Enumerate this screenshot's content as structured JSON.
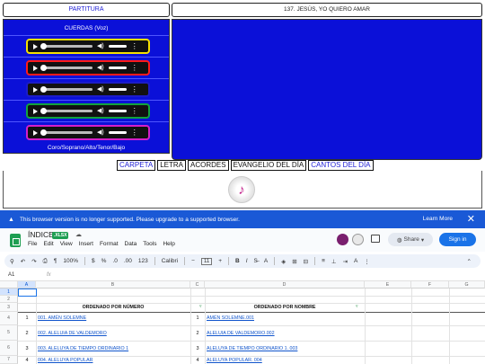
{
  "partitura": "PARTITURA",
  "song_title": "137. JESÚS, YO QUIERO AMAR",
  "cuerdas_label": "CUERDAS (Voz)",
  "players": [
    {
      "voice": "voice-1",
      "border": "#f5e000"
    },
    {
      "voice": "voice-2",
      "border": "#ff1a1a"
    },
    {
      "voice": "voice-3",
      "border": "#1c1cc8"
    },
    {
      "voice": "voice-4",
      "border": "#11a33e"
    },
    {
      "voice": "voice-5",
      "border": "#d41fc9"
    }
  ],
  "coro_label": "Coro/Soprano/Alto/Tenor/Bajo",
  "tabs": [
    "CARPETA",
    "LETRA",
    "ACORDES",
    "EVANGELIO DEL DÍA",
    "CANTOS DEL DÍA"
  ],
  "banner": {
    "message": "This browser version is no longer supported. Please upgrade to a supported browser.",
    "learn_more": "Learn More",
    "close": "✕"
  },
  "sheet": {
    "title": "ÍNDICE",
    "badge": ".XLSX",
    "menu": [
      "File",
      "Edit",
      "View",
      "Insert",
      "Format",
      "Data",
      "Tools",
      "Help"
    ],
    "share": "Share",
    "sign_in": "Sign in",
    "toolbar": {
      "zoom": "100%",
      "currency": "$",
      "percent": "%",
      "dec_less": ".0",
      "dec_more": ".00",
      "num_format": "123",
      "font": "Calibri",
      "font_size": "11",
      "minus": "−",
      "plus": "+",
      "bold": "B",
      "italic": "I"
    },
    "cell_ref": "A1",
    "fx": "fx",
    "columns": [
      "A",
      "B",
      "C",
      "D",
      "E",
      "F",
      "G"
    ],
    "row_numbers": [
      "1",
      "2",
      "3",
      "4",
      "5",
      "6",
      "7"
    ],
    "header_left": "ORDENADO POR NÚMERO",
    "header_right": "ORDENADO POR NOMBRE",
    "rows": [
      {
        "n": "1",
        "left": "001. AMÉN SOLEMNE",
        "n2": "1",
        "right": "AMÉN SOLEMNE.001"
      },
      {
        "n": "2",
        "left": "002. ALELUIA DE VALDEMORO",
        "n2": "2",
        "right": "ALELUIA DE VALDEMORO.002"
      },
      {
        "n": "3",
        "left": "003. ALELUYA DE TIEMPO ORDINARIO 1",
        "n2": "3",
        "right": "ALELUYA DE TIEMPO ORDINARIO 1. 003"
      },
      {
        "n": "4",
        "left": "004. ALELUYA POPULAR",
        "n2": "4",
        "right": "ALELUYA POPULAR. 004"
      }
    ]
  }
}
